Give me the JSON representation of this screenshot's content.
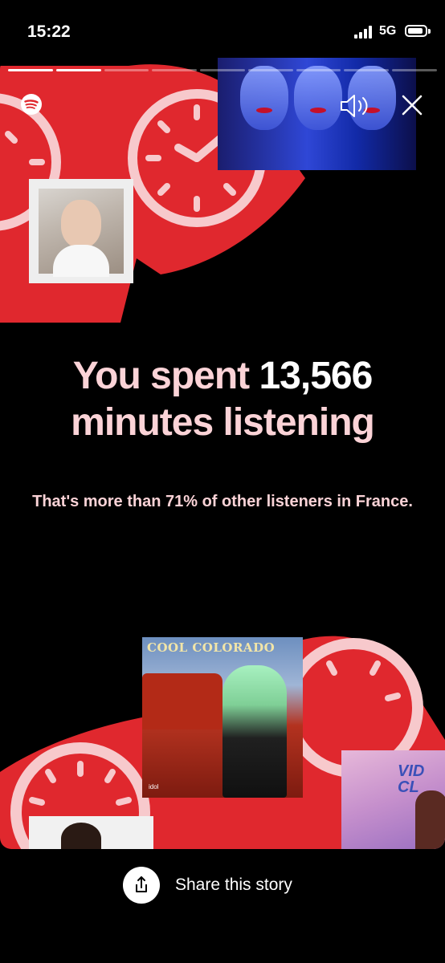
{
  "status_bar": {
    "time": "15:22",
    "network": "5G",
    "signal_icon": "cellular-signal-icon",
    "battery_icon": "battery-icon"
  },
  "story": {
    "progress_segments_total": 9,
    "progress_segments_done": 2,
    "app_logo_icon": "spotify-logo-icon",
    "controls": {
      "mute_icon": "speaker-icon",
      "close_icon": "close-icon"
    },
    "headline": {
      "part1": "You spent ",
      "minutes": "13,566",
      "part2": "minutes listening"
    },
    "subline": "That's more than 71% of other listeners in France.",
    "albums": {
      "cool_colorado_title": "COOL COLORADO",
      "cool_colorado_logos": "idol",
      "third_album_title": "VID CL"
    }
  },
  "share": {
    "label": "Share this story",
    "icon": "share-icon"
  },
  "colors": {
    "background": "#000000",
    "accent_red": "#e0282e",
    "accent_pink": "#fbd3d7",
    "clock_face": "#f7c9cc"
  }
}
